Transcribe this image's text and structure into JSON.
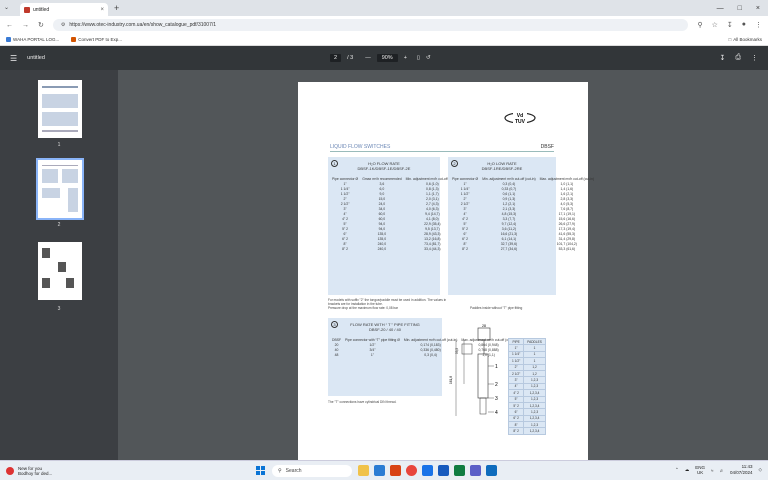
{
  "browser": {
    "tab_title": "untitled",
    "url": "https://www.otec-industry.com.ua/en/show_catalogue_pdf/31007/1",
    "bookmarks": [
      "WAHA PORTAL LOG...",
      "Convert PDF to Exp..."
    ],
    "all_bookmarks": "All Bookmarks"
  },
  "pdf_toolbar": {
    "title": "untitled",
    "page_current": "2",
    "page_total": "/ 3",
    "zoom": "90%",
    "zoom_out": "—",
    "zoom_in": "+"
  },
  "thumbnails": [
    {
      "label": "1"
    },
    {
      "label": "2"
    },
    {
      "label": "3"
    }
  ],
  "doc": {
    "logo": "Vd TUV",
    "section_title": "LIQUID FLOW SWITCHES",
    "code": "DBSF",
    "table1": {
      "marker": "1",
      "title_line1": "H₂O FLOW RATE",
      "title_line2": "DBSF-1K/DBSF-1E/DBSF-2E",
      "headers": [
        "Pipe connector Ø",
        "Gmax m³/h recommended",
        "Min. adjustment m³/h cut-off (cut-in)",
        "Max. adjustment m³/h cut-off (cut-in)"
      ],
      "rows": [
        [
          "1\"",
          "3,6",
          "0,6 (1,0)",
          "2,0 (2,1)"
        ],
        [
          "1 1/4\"",
          "6,0",
          "0,8 (1,3)",
          "2,8 (3,0)"
        ],
        [
          "1 1/2\"",
          "9,0",
          "1,1 (1,7)",
          "3,7 (4,0)"
        ],
        [
          "2\"",
          "15,0",
          "2,0 (3,1)",
          "5,7 (6,1)"
        ],
        [
          "2 1/2\"",
          "24,0",
          "2,7 (4,3)",
          "6,6 (7,0)"
        ],
        [
          "3\"",
          "34,0",
          "4,0 (6,3)",
          "10,2 (11,0)"
        ],
        [
          "4\"",
          "60,0",
          "9,4 (14,7)",
          "20,7 (29,0)"
        ],
        [
          "4\" 2",
          "60,0",
          "4,1 (8,0)",
          "17,2 (18,6)"
        ],
        [
          "5\"",
          "94,0",
          "22,9 (35,4)",
          "25,3 (35,0)"
        ],
        [
          "5\" 2",
          "94,0",
          "9,5 (13,7)",
          "33,0 (34,6)"
        ],
        [
          "6\"",
          "135,0",
          "28,9 (43,3)",
          "41,7 (49,1)"
        ],
        [
          "6\" 2",
          "135,0",
          "13,2 (16,8)",
          "33,6 (31,7)"
        ],
        [
          "8\"",
          "240,0",
          "73,4 (81,7)",
          "140,7 (175,2)"
        ],
        [
          "8\" 2",
          "240,0",
          "33,4 (44,3)",
          "90,8 (114,2)"
        ]
      ]
    },
    "table2": {
      "marker": "2",
      "title_line1": "H₂O LOW RATE",
      "title_line2": "DBSF-1RE/DBSF-2RE",
      "headers": [
        "Pipe connector Ø",
        "Min. adjustment m³/h cut-off (cut-in)",
        "Max. adjustment m³/h cut-off (cut-in)"
      ],
      "rows": [
        [
          "1\"",
          "0,3 (0,4)",
          "1,0 (1,1)"
        ],
        [
          "1 1/4\"",
          "0,33 (0,7)",
          "1,4 (1,6)"
        ],
        [
          "1 1/2\"",
          "0,6 (1,1)",
          "1,6 (2,1)"
        ],
        [
          "2\"",
          "0,9 (1,3)",
          "2,8 (3,3)"
        ],
        [
          "2 1/2\"",
          "1,2 (2,1)",
          "4,0 (5,3)"
        ],
        [
          "3\"",
          "2,1 (3,3)",
          "7,6 (8,7)"
        ],
        [
          "4\"",
          "4,8 (15,3)",
          "17,1 (19,1)"
        ],
        [
          "4\" 2",
          "3,3 (7,7)",
          "15,6 (16,6)"
        ],
        [
          "5\"",
          "9,7 (12,4)",
          "26,6 (27,9)"
        ],
        [
          "5\" 2",
          "3,6 (11,2)",
          "17,3 (19,4)"
        ],
        [
          "6\"",
          "16,6 (21,3)",
          "41,6 (55,3)"
        ],
        [
          "6\" 2",
          "6,1 (14,1)",
          "31,4 (29,8)"
        ],
        [
          "8\"",
          "32,7 (39,6)",
          "101,7 (104,2)"
        ],
        [
          "8\" 2",
          "27,7 (34,6)",
          "53,3 (61,6)"
        ]
      ]
    },
    "note1": "For models with suffix \"2\" the tongue/paddle must be used in addition. The values in brackets are for installation in the tube.",
    "note2": "Pressure drop at the maximum flow rate: 0,08 bar",
    "table3": {
      "marker": "3",
      "title_line1": "FLOW RATE WITH “ T ” PIPE FITTING",
      "title_line2": "DBSF-20 / 40 / 40",
      "headers": [
        "DBSF",
        "Pipe connector with “T” pipe fitting Ø",
        "Min. adjustment m³/h cut-off (cut-in)",
        "Max. adjustment m³/h cut-off (cut-in)"
      ],
      "rows": [
        [
          "20",
          "1/2\"",
          "0,174 (0,183)",
          "0,864 (0,948)"
        ],
        [
          "40",
          "3/4\"",
          "0,336 (0,480)",
          "0,768 (0,888)"
        ],
        [
          "48",
          "1\"",
          "0,3 (0,4)",
          "1,0 (1,1)"
        ]
      ],
      "note": "The \"T\" connections have cylindrical DIN thread."
    },
    "paddles_note": "Paddles inside without \"T\" pipe fitting",
    "paddles": {
      "headers": [
        "PIPE",
        "PADDLES"
      ],
      "rows": [
        [
          "1\"",
          "1"
        ],
        [
          "1 1/4\"",
          "1"
        ],
        [
          "1 1/2\"",
          "1"
        ],
        [
          "2\"",
          "1,2"
        ],
        [
          "2 1/2\"",
          "1,2"
        ],
        [
          "3\"",
          "1,2,3"
        ],
        [
          "4\"",
          "1,2,3"
        ],
        [
          "4\" 2",
          "1,2,3,4"
        ],
        [
          "5\"",
          "1,2,3"
        ],
        [
          "5\" 2",
          "1,2,3,4"
        ],
        [
          "6\"",
          "1,2,3"
        ],
        [
          "6\" 2",
          "1,2,3,4"
        ],
        [
          "8\"",
          "1,2,3"
        ],
        [
          "8\" 2",
          "1,2,3,4"
        ]
      ]
    },
    "drawing_labels": {
      "top": "28",
      "left1": "53,5",
      "left2": "161,8",
      "l1": "1",
      "l2": "2",
      "l3": "3",
      "l4": "4"
    }
  },
  "taskbar": {
    "news_line1": "New for you",
    "news_line2": "Bodhoy for ded...",
    "search": "Search",
    "lang_line1": "ENG",
    "lang_line2": "UK",
    "time": "11:43",
    "date": "04/07/2024"
  }
}
